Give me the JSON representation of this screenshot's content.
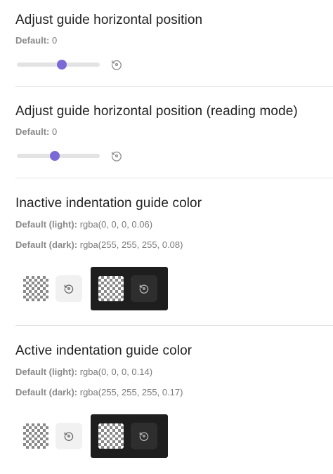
{
  "sections": [
    {
      "title": "Adjust guide horizontal position",
      "defaults": [
        {
          "label": "Default:",
          "value": "0"
        }
      ],
      "slider_value": 0.54
    },
    {
      "title": "Adjust guide horizontal position (reading mode)",
      "defaults": [
        {
          "label": "Default:",
          "value": "0"
        }
      ],
      "slider_value": 0.46
    },
    {
      "title": "Inactive indentation guide color",
      "defaults": [
        {
          "label": "Default (light):",
          "value": "rgba(0, 0, 0, 0.06)"
        },
        {
          "label": "Default (dark):",
          "value": "rgba(255, 255, 255, 0.08)"
        }
      ]
    },
    {
      "title": "Active indentation guide color",
      "defaults": [
        {
          "label": "Default (light):",
          "value": "rgba(0, 0, 0, 0.14)"
        },
        {
          "label": "Default (dark):",
          "value": "rgba(255, 255, 255, 0.17)"
        }
      ]
    }
  ],
  "colors": {
    "accent": "#7b6ad6",
    "track": "#e3e3e3",
    "dark_panel": "#1e1e1e",
    "divider": "#e2e2e2"
  },
  "icons": {
    "reset": "reset-icon"
  }
}
